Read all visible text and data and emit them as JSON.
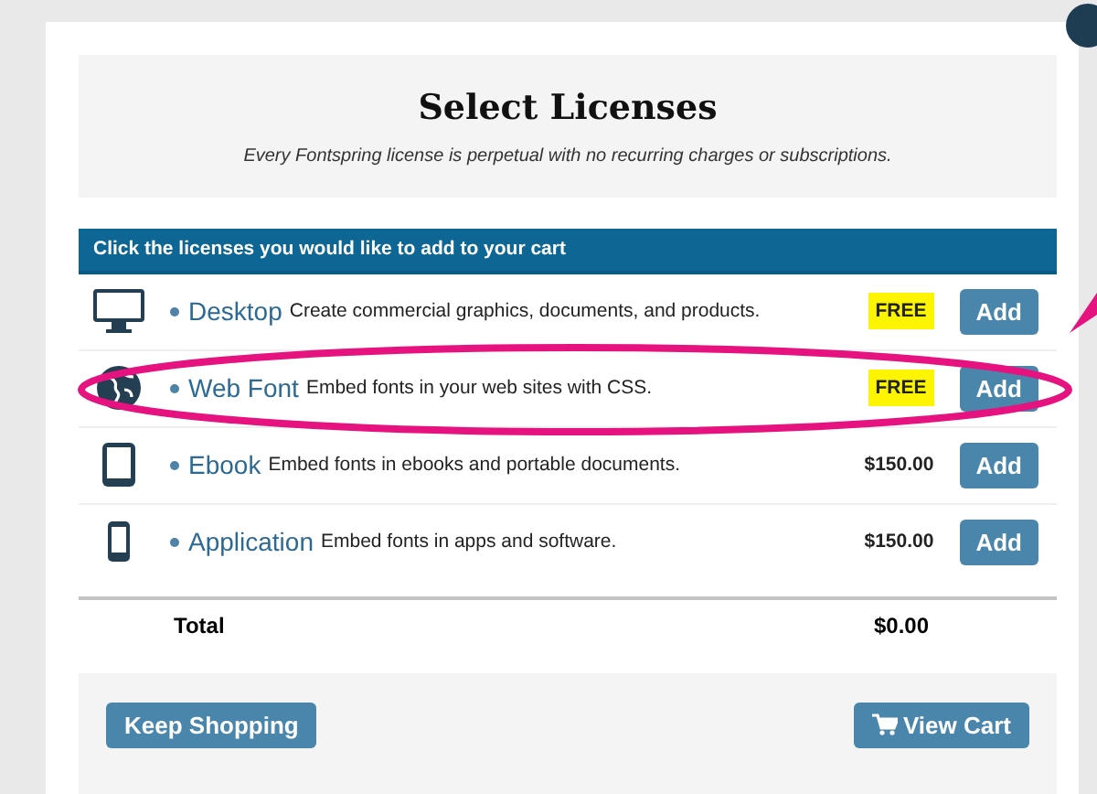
{
  "dialog": {
    "title": "Select Licenses",
    "subtitle": "Every Fontspring license is perpetual with no recurring charges or subscriptions."
  },
  "table": {
    "header": "Click the licenses you would like to add to your cart",
    "rows": [
      {
        "kind": "desktop",
        "name": "Desktop",
        "description": "Create commercial graphics, documents, and products.",
        "price": "FREE",
        "highlighted": true,
        "button": "Add",
        "circled": false
      },
      {
        "kind": "globe",
        "name": "Web Font",
        "description": "Embed fonts in your web sites with CSS.",
        "price": "FREE",
        "highlighted": true,
        "button": "Add",
        "circled": true
      },
      {
        "kind": "tablet",
        "name": "Ebook",
        "description": "Embed fonts in ebooks and portable documents.",
        "price": "$150.00",
        "highlighted": false,
        "button": "Add",
        "circled": false
      },
      {
        "kind": "phone",
        "name": "Application",
        "description": "Embed fonts in apps and software.",
        "price": "$150.00",
        "highlighted": false,
        "button": "Add",
        "circled": false
      }
    ],
    "total_label": "Total",
    "total_value": "$0.00"
  },
  "footer": {
    "left_button": "Keep Shopping",
    "right_button": "View Cart"
  }
}
